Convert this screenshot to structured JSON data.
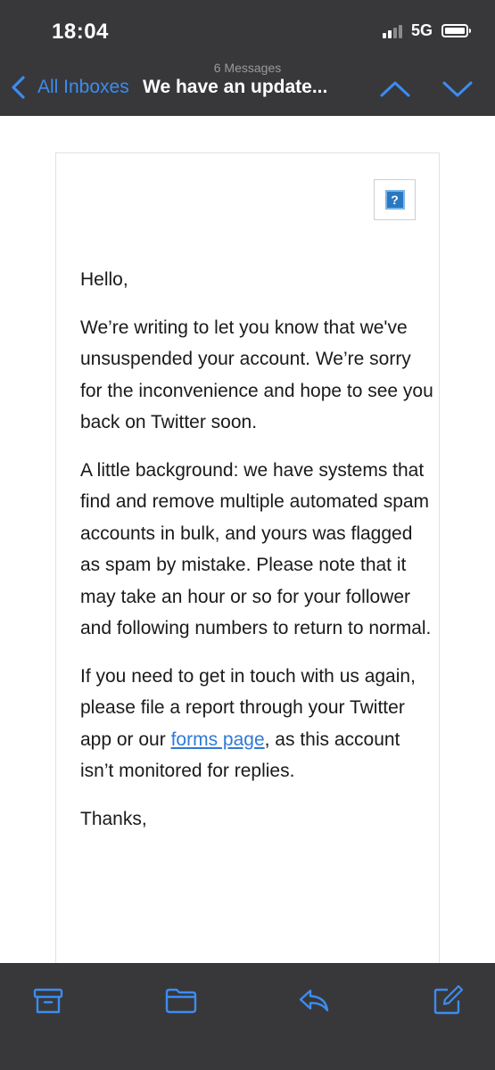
{
  "status_bar": {
    "time": "18:04",
    "network": "5G"
  },
  "nav": {
    "message_count": "6 Messages",
    "back_label": "All Inboxes",
    "subject": "We have an update..."
  },
  "message": {
    "greeting": "Hello,",
    "paragraph1": "We’re writing to let you know that we've unsuspended your account. We’re sorry for the inconvenience and hope to see you back on Twitter soon.",
    "paragraph2": "A little background: we have systems that find and remove multiple automated spam accounts in bulk, and yours was flagged as spam by mistake. Please note that it may take an hour or so for your follower and following numbers to return to normal.",
    "paragraph3_before": "If you need to get in touch with us again, please file a report through your Twitter app or our ",
    "paragraph3_link": "forms page",
    "paragraph3_after": ", as this account isn’t monitored for replies.",
    "signoff": "Thanks,",
    "image_placeholder": "?"
  },
  "toolbar": {
    "icons": [
      "archive-icon",
      "folder-icon",
      "reply-icon",
      "compose-icon"
    ]
  },
  "colors": {
    "bar_background": "#38383a",
    "accent": "#3c8cf0",
    "link": "#2f7ad6"
  }
}
